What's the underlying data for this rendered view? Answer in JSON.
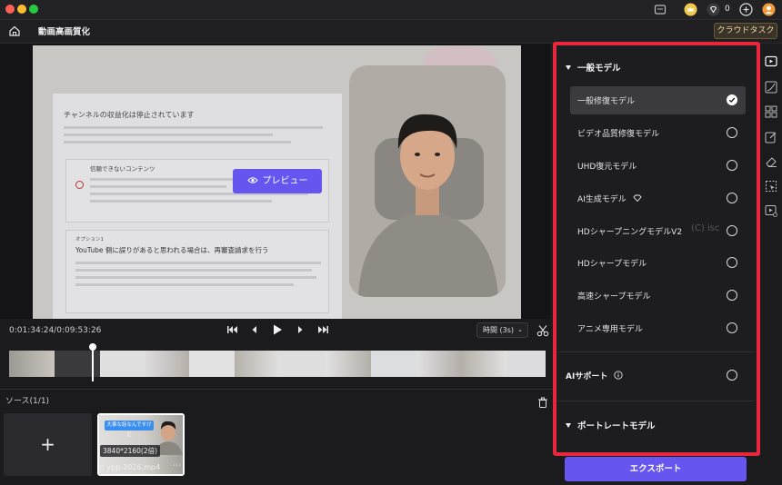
{
  "window": {
    "traffic_lights": [
      "#fe5f57",
      "#febc2e",
      "#28c840"
    ],
    "badge_count": "0"
  },
  "nav": {
    "title": "動画高画質化",
    "cloud_task_label": "クラウドタスク"
  },
  "preview": {
    "button_label": "プレビュー",
    "doc_heading": "チャンネルの収益化は停止されています",
    "doc_unreliable": "信頼できないコンテンツ",
    "doc_option": "オプション1",
    "doc_appeal": "YouTube 側に誤りがあると思われる場合は、再審査請求を行う"
  },
  "controls": {
    "timecode": "0:01:34:24/0:09:53:26",
    "speed_select": "時間 (3s)"
  },
  "source": {
    "label": "ソース(1/1)",
    "add_symbol": "+",
    "clip_resolution": "3840*2160(2倍)",
    "clip_name": "ypp-2026.mp4",
    "clip_caption": "大事な話なんですけど"
  },
  "panel": {
    "general_section": "一般モデル",
    "models": [
      {
        "label": "一般修復モデル",
        "selected": true
      },
      {
        "label": "ビデオ品質修復モデル",
        "selected": false
      },
      {
        "label": "UHD復元モデル",
        "selected": false
      },
      {
        "label": "AI生成モデル",
        "selected": false
      },
      {
        "label": "HDシャープニングモデルV2",
        "selected": false
      },
      {
        "label": "HDシャープモデル",
        "selected": false
      },
      {
        "label": "高速シャープモデル",
        "selected": false
      },
      {
        "label": "アニメ専用モデル",
        "selected": false
      }
    ],
    "ai_support": "AIサポート",
    "portrait_section": "ポートレートモデル",
    "export_label": "エクスポート",
    "watermark": "(C) isc"
  },
  "colors": {
    "accent": "#6655ee",
    "highlight_border": "#e8263c"
  }
}
